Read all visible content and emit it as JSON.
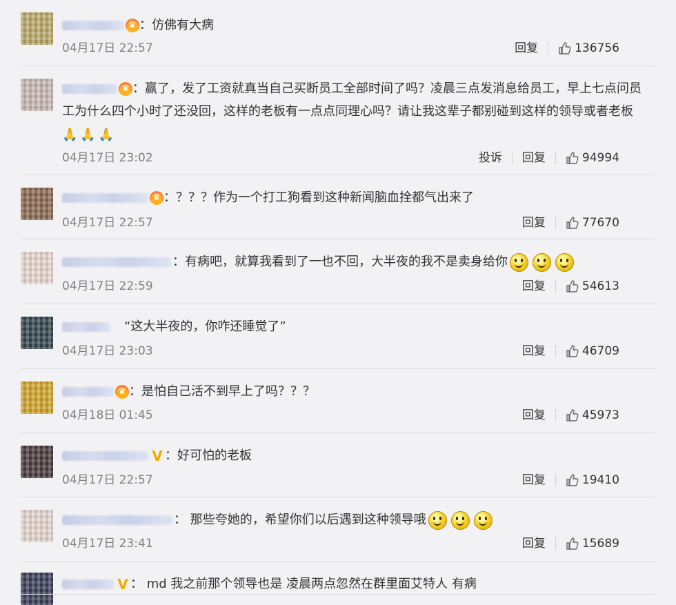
{
  "comments": [
    {
      "text": "：仿佛有大病",
      "time": "04月17日 22:57",
      "reply": "回复",
      "likes": "136756",
      "badge": "crown",
      "name_width": 90,
      "avatar_color": "#b9a86a"
    },
    {
      "text": "：赢了，发了工资就真当自己买断员工全部时间了吗？凌晨三点发消息给员工，早上七点问员工为什么四个小时了还没回，这样的老板有一点点同理心吗？请让我这辈子都别碰到这样的领导或者老板",
      "time": "04月17日 23:02",
      "report": "投诉",
      "reply": "回复",
      "likes": "94994",
      "badge": "crown",
      "name_width": 80,
      "avatar_color": "#c9b8b4"
    },
    {
      "text": "：？？？作为一个打工狗看到这种新闻脑血拴都气出来了",
      "time": "04月17日 22:57",
      "reply": "回复",
      "likes": "77670",
      "badge": "crown",
      "name_width": 125,
      "avatar_color": "#8a6a52"
    },
    {
      "text": "：有病吧，就算我看到了一也不回，大半夜的我不是卖身给你",
      "time": "04月17日 22:59",
      "reply": "回复",
      "likes": "54613",
      "badge": "",
      "name_width": 158,
      "avatar_color": "#e8d7cf"
    },
    {
      "text": "“这大半夜的，你咋还睡觉了”",
      "time": "04月17日 23:03",
      "reply": "回复",
      "likes": "46709",
      "badge": "",
      "name_width": 70,
      "avatar_color": "#33454e"
    },
    {
      "text": "：是怕自己活不到早上了吗？？？",
      "time": "04月18日 01:45",
      "reply": "回复",
      "likes": "45973",
      "badge": "crown",
      "name_width": 75,
      "avatar_color": "#d1a52a"
    },
    {
      "text": "：好可怕的老板",
      "time": "04月17日 22:57",
      "reply": "回复",
      "likes": "19410",
      "badge": "vip",
      "name_width": 125,
      "avatar_color": "#4a3a3a"
    },
    {
      "text": "：  那些夸她的，希望你们以后遇到这种领导哦",
      "time": "04月17日 23:41",
      "reply": "回复",
      "likes": "15689",
      "badge": "",
      "name_width": 160,
      "avatar_color": "#e6d6cf"
    },
    {
      "text": "：  md 我之前那个领导也是 凌晨两点忽然在群里面艾特人 有病",
      "time": "",
      "reply": "",
      "likes": "",
      "badge": "vipgold",
      "name_width": 75,
      "avatar_color": "#3b3f58"
    }
  ],
  "icons": {
    "like": "thumbs-up-icon",
    "emoji_smile": "smile-emoji-icon",
    "emoji_pray": "pray-emoji-icon",
    "emoji_fist": "fist-emoji-icon",
    "badge_crown": "crown-badge-icon",
    "badge_vip": "vip-badge-icon"
  },
  "colors": {
    "background": "#f2f2f5",
    "meta_text": "#808080",
    "badge": "#f2a900"
  }
}
